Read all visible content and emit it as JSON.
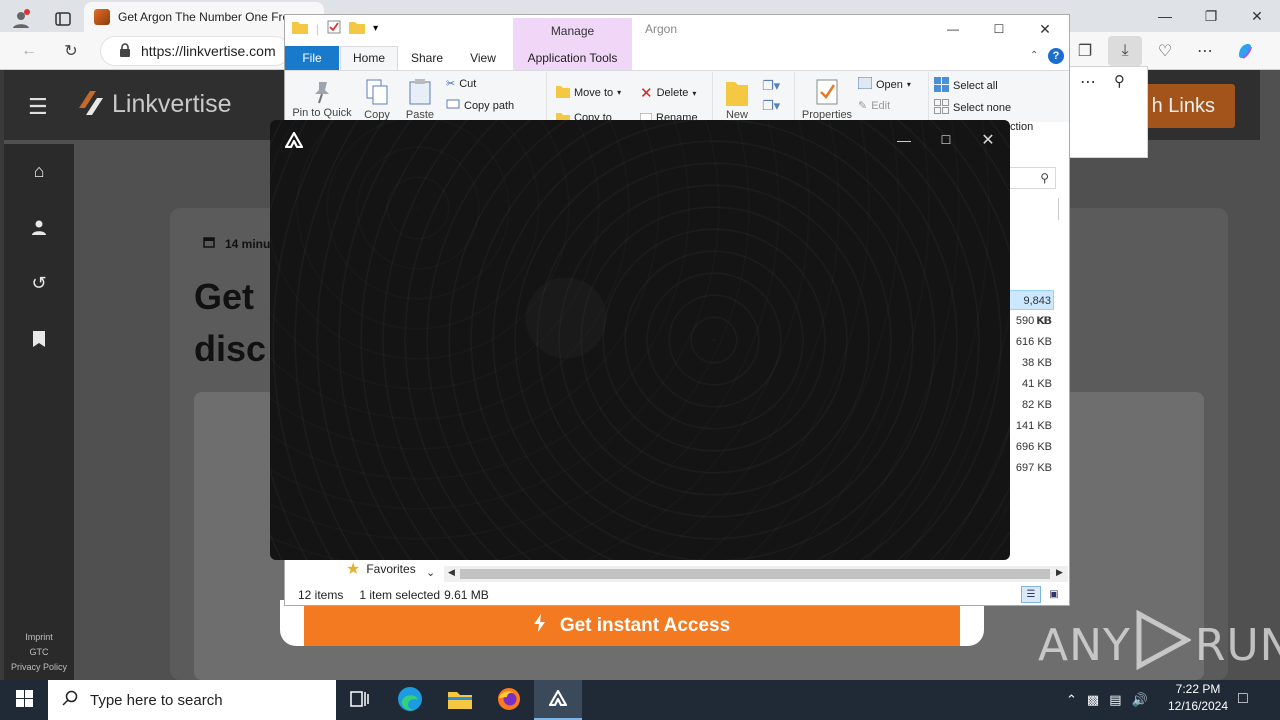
{
  "browser": {
    "tab_title": "Get Argon The Number One Fre",
    "url": "https://linkvertise.com",
    "window_buttons": [
      "minimize",
      "restore",
      "close"
    ]
  },
  "linkvertise": {
    "brand": "Linkvertise",
    "read_time": "14 minu",
    "title_line1": "Get ",
    "title_line2": "disc",
    "header_action": "h Links",
    "cta_label": "Get instant Access",
    "footer_links": [
      "Imprint",
      "GTC",
      "Privacy Policy"
    ]
  },
  "explorer": {
    "window_title": "Argon",
    "contextual_tab_group": "Manage",
    "tabs": [
      "File",
      "Home",
      "Share",
      "View",
      "Application Tools"
    ],
    "ribbon": {
      "pin_to_quick": "Pin to Quick",
      "copy": "Copy",
      "paste": "Paste",
      "cut": "Cut",
      "copy_path": "Copy path",
      "move_to": "Move to",
      "copy_to": "Copy to",
      "delete": "Delete",
      "rename": "Rename",
      "new": "New",
      "properties": "Properties",
      "open": "Open",
      "edit": "Edit",
      "select_all": "Select all",
      "select_none": "Select none",
      "invert_selection": "ction"
    },
    "file_sizes": [
      "9,843 KB",
      "590 KB",
      "616 KB",
      "38 KB",
      "41 KB",
      "82 KB",
      "141 KB",
      "696 KB",
      "697 KB"
    ],
    "nav_favorites": "Favorites",
    "status": {
      "item_count": "12 items",
      "selection": "1 item selected",
      "selection_size": "9.61 MB"
    }
  },
  "watermark": {
    "text_left": "ANY",
    "text_right": "RUN"
  },
  "taskbar": {
    "search_placeholder": "Type here to search",
    "time": "7:22 PM",
    "date": "12/16/2024"
  },
  "colors": {
    "linkvertise_orange": "#f47a22",
    "explorer_file_tab": "#1979ca",
    "manage_tab": "#f0d7f8",
    "argon_bg": "#141414",
    "taskbar": "#1f2a36"
  }
}
